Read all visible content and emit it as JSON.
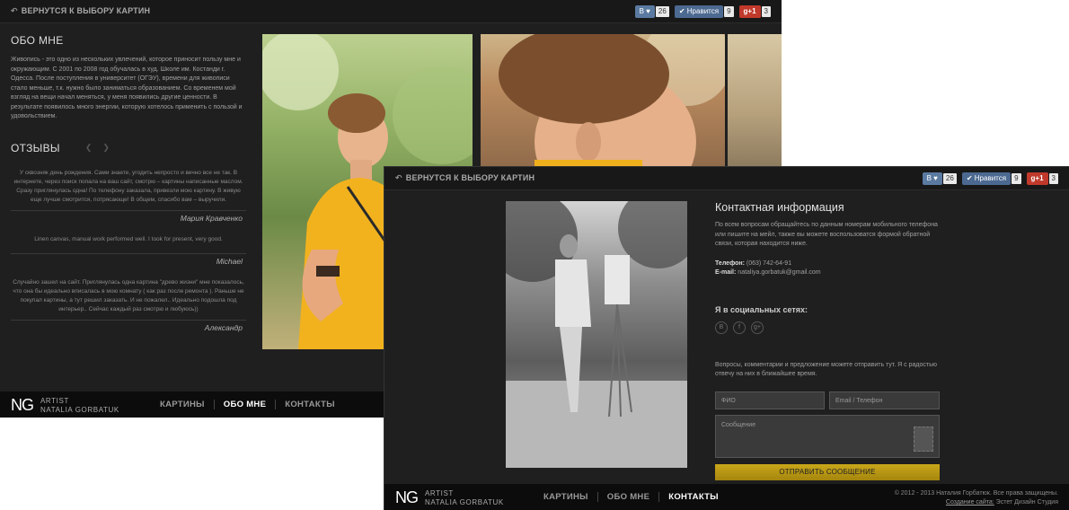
{
  "about_page": {
    "back_label": "ВЕРНУТСЯ К ВЫБОРУ КАРТИН",
    "social": {
      "vk_label": "В",
      "vk_count": "26",
      "like_label": "Нравится",
      "like_count": "9",
      "gplus_label": "g+1",
      "gplus_count": "3"
    },
    "about_title": "ОБО МНЕ",
    "about_text": "Живопись - это одно из нескольких увлечений, которое приносит пользу мне и окружающим. С 2001 по 2008 год обучалась в худ. Школе им. Костанди г. Одесса. После поступления в университет (ОГЭУ), времени для живописи стало меньше, т.к. нужно было заниматься образованием. Со временем мой взгляд на вещи начал меняться, у меня появились другие ценности. В результате появилось много энергии, которую хотелось применить с пользой и удовольствием.",
    "reviews_title": "ОТЗЫВЫ",
    "reviews": [
      {
        "text": "У сквозняк день рождения. Сами знаете, угодить непросто и вечно все не так. В интернете, через поиск попала на ваш сайт, смотрю – картины написанные маслом. Сразу приглянулась одна! По телефону заказала, привезли мою картину. В живую еще лучше смотрится, потрясающе! В общем, спасибо вам – выручили.",
        "author": "Мария Кравченко"
      },
      {
        "text": "Linen canvas, manual work performed well. I took for present, very good.",
        "author": "Michael"
      },
      {
        "text": "Случайно зашел на сайт. Приглянулась одна картина \"древо жизни\" мне показалось, что она бы идеально вписалась в мою комнату ( как раз после ремонта ). Раньше не покупал картины, а тут решил заказать. И не пожалел.. Идеально подошла под интерьер.. Сейчас каждый раз смотрю и любуюсь))",
        "author": "Александр"
      }
    ],
    "footer": {
      "logo_ng": "NG",
      "logo_line1": "ARTIST",
      "logo_line2": "NATALIA GORBATUK",
      "nav": [
        "КАРТИНЫ",
        "ОБО МНЕ",
        "КОНТАКТЫ"
      ],
      "active_index": 1
    }
  },
  "contact_page": {
    "back_label": "ВЕРНУТСЯ К ВЫБОРУ КАРТИН",
    "social": {
      "vk_label": "В",
      "vk_count": "26",
      "like_label": "Нравится",
      "like_count": "9",
      "gplus_label": "g+1",
      "gplus_count": "3"
    },
    "title": "Контактная информация",
    "intro": "По всем вопросам обращайтесь по данным номерам мобильного телефона или пишите на мейл, также вы можете воспользоватся формой обратной связи, которая находится ниже.",
    "phone_label": "Телефон:",
    "phone_value": "(063) 742-64-91",
    "email_label": "E-mail:",
    "email_value": "nataliya.gorbatuk@gmail.com",
    "social_title": "Я в социальных сетях:",
    "social_icons": [
      "В",
      "f",
      "g+"
    ],
    "form_intro": "Вопросы, комментарии и предложение можете отправить тут. Я с радостью отвечу на них в ближайшее время.",
    "name_placeholder": "ФИО",
    "contact_placeholder": "Email / Телефон",
    "message_placeholder": "Сообщение",
    "submit_label": "ОТПРАВИТЬ СООБЩЕНИЕ",
    "footer": {
      "logo_ng": "NG",
      "logo_line1": "ARTIST",
      "logo_line2": "NATALIA GORBATUK",
      "nav": [
        "КАРТИНЫ",
        "ОБО МНЕ",
        "КОНТАКТЫ"
      ],
      "active_index": 2,
      "copyright": "© 2012 - 2013 Наталия Горбатюк. Все права защищены.",
      "credit_label": "Создание сайта:",
      "credit_value": "Эстет Дизайн Студия"
    }
  }
}
